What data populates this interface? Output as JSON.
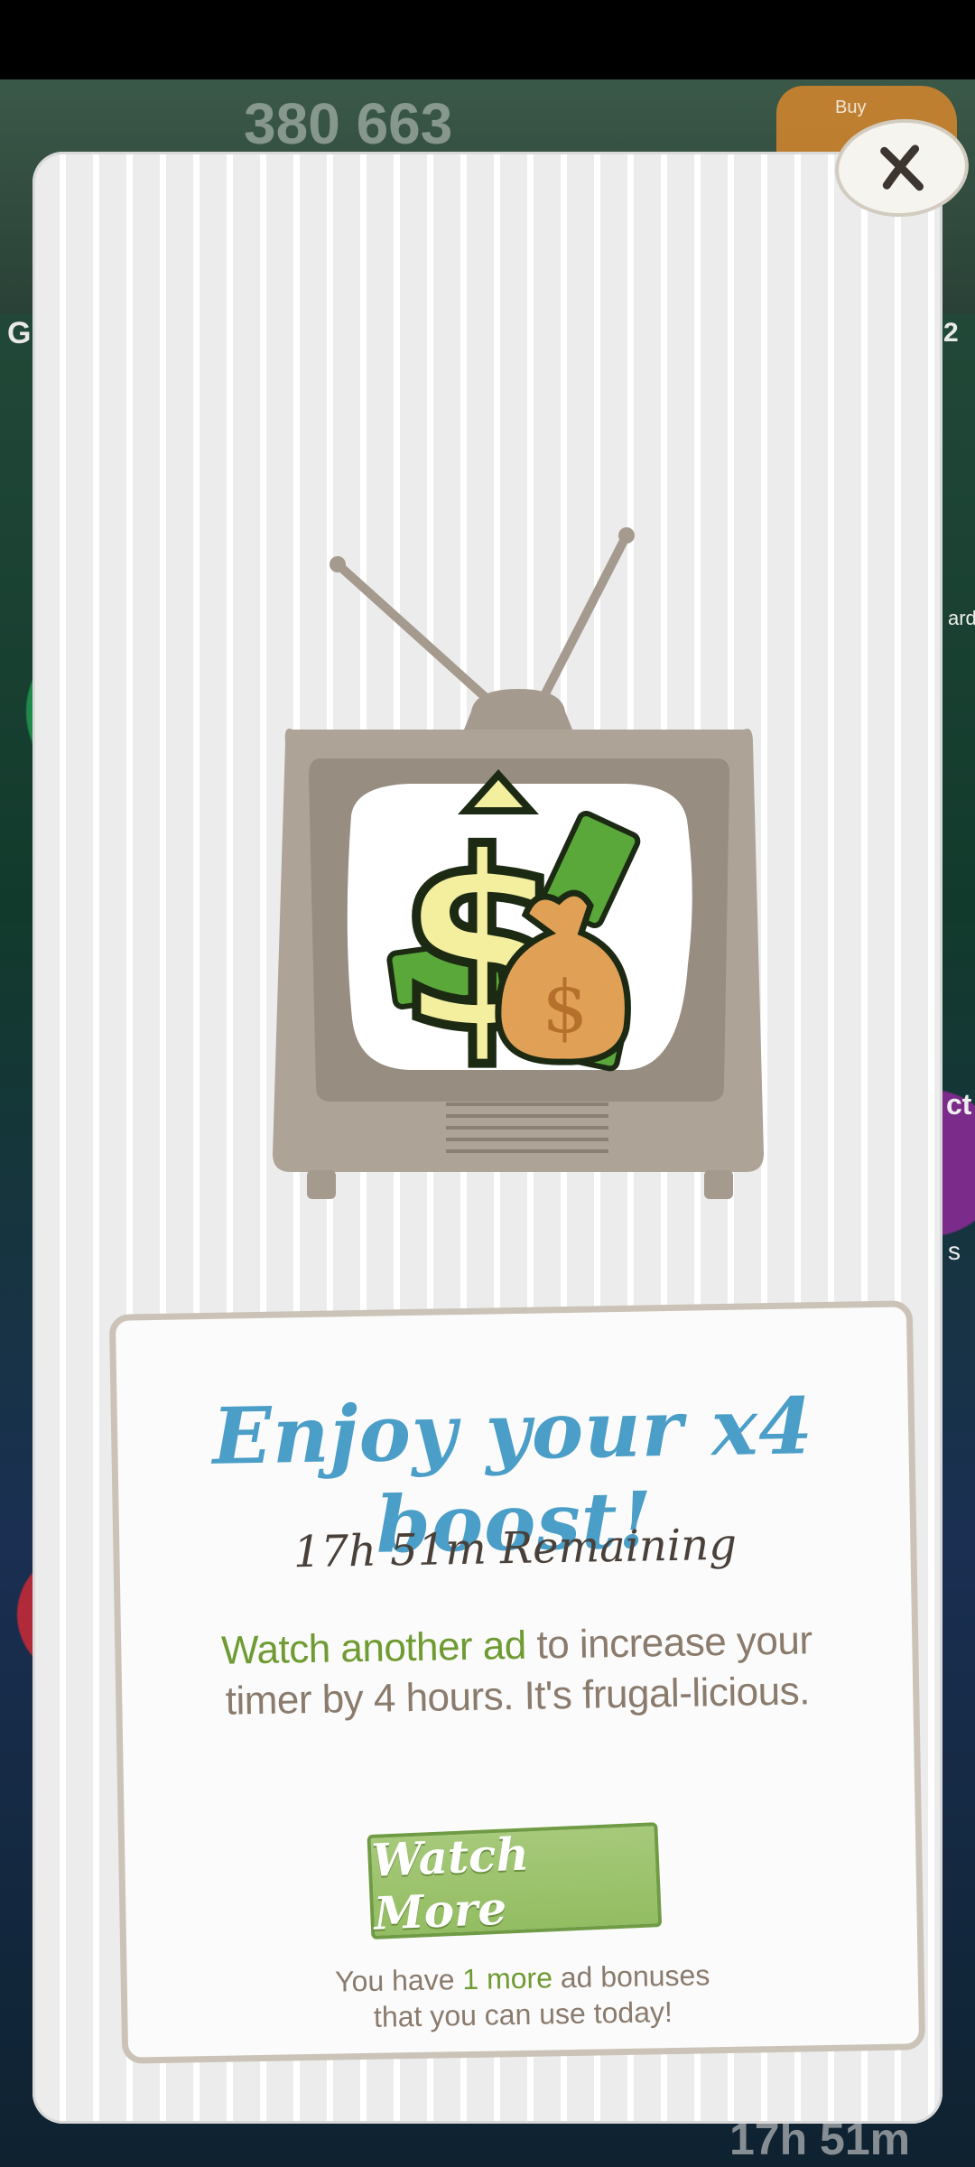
{
  "background": {
    "score": "380 663",
    "buy_label": "Buy",
    "edge_left_letter": "G",
    "edge_right_digit": "2",
    "edge_right_ard": "ard",
    "edge_right_ct": "ct",
    "edge_right_s": "s",
    "bottom_timer": "17h 51m"
  },
  "modal": {
    "close_label": "x",
    "title": "Enjoy your x4 boost!",
    "remaining": "17h 51m Remaining",
    "description": {
      "highlight": "Watch another ad",
      "rest_line1": " to increase your",
      "line2": "timer by 4 hours. It's frugal-licious."
    },
    "watch_button_label": "Watch More",
    "bonus_note": {
      "prefix": "You have ",
      "highlight": "1 more",
      "suffix_line1": " ad bonuses",
      "line2": "that you can use today!"
    }
  },
  "colors": {
    "title": "#4a9ec7",
    "highlight_green": "#6f9b32",
    "button_green": "#9cc26c",
    "tv_body": "#ada397",
    "money_green": "#5aa83a",
    "bag_orange": "#e0a056"
  },
  "icons": {
    "tv": "retro-tv-icon",
    "dollar": "dollar-sign-icon",
    "money_bag": "money-bag-icon",
    "close": "close-icon"
  }
}
